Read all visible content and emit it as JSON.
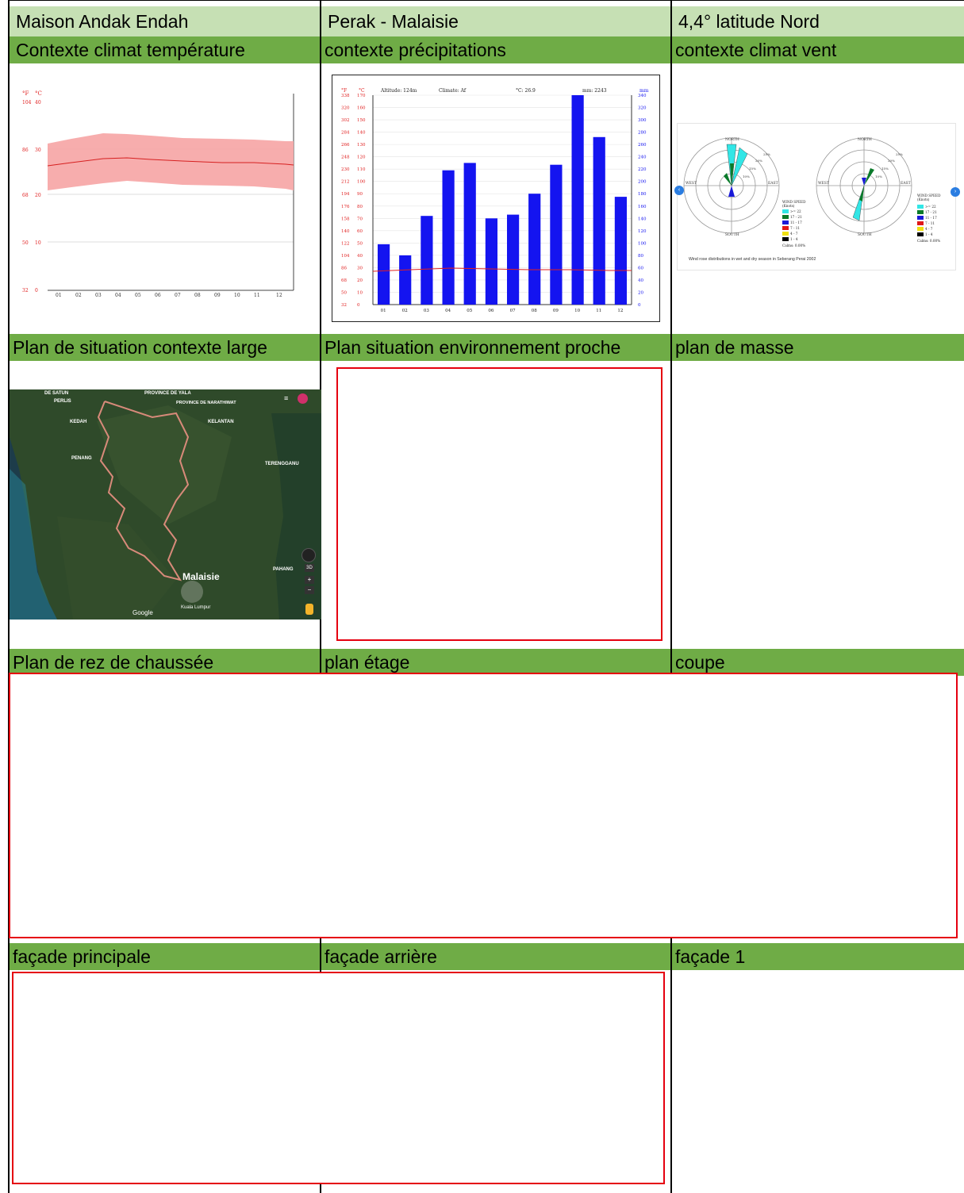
{
  "title_row": [
    "Maison Andak Endah",
    "Perak - Malaisie",
    "4,4° latitude Nord"
  ],
  "row1_headers": [
    "Contexte climat température",
    "contexte précipitations",
    "contexte climat vent"
  ],
  "row2_headers": [
    "Plan de situation contexte large",
    "Plan situation environnement proche",
    "plan  de masse"
  ],
  "row3_headers": [
    "Plan de rez de chaussée",
    "plan étage",
    "coupe"
  ],
  "row4_headers": [
    "façade principale",
    "façade arrière",
    "façade 1"
  ],
  "temp_chart": {
    "f_ticks": [
      "104",
      "86",
      "68",
      "50",
      "32"
    ],
    "c_ticks": [
      "40",
      "30",
      "20",
      "10",
      "0"
    ],
    "f_unit": "°F",
    "c_unit": "°C",
    "months": [
      "01",
      "02",
      "03",
      "04",
      "05",
      "06",
      "07",
      "08",
      "09",
      "10",
      "11",
      "12"
    ],
    "colors": {
      "band": "#f7a9a9",
      "line": "#d62020"
    }
  },
  "precip_chart": {
    "header": {
      "altitude": "Altitude: 124m",
      "climate": "Climate: Af",
      "temp": "°C: 26.9",
      "precip": "mm: 2243"
    },
    "f_unit": "°F",
    "c_unit": "°C",
    "mm_unit": "mm",
    "f_ticks": [
      "338",
      "320",
      "302",
      "284",
      "266",
      "248",
      "230",
      "212",
      "194",
      "176",
      "158",
      "140",
      "122",
      "104",
      "86",
      "68",
      "50",
      "32"
    ],
    "c_ticks": [
      "170",
      "160",
      "150",
      "140",
      "130",
      "120",
      "110",
      "100",
      "90",
      "80",
      "70",
      "60",
      "50",
      "40",
      "30",
      "20",
      "10",
      "0"
    ],
    "mm_ticks": [
      "340",
      "320",
      "300",
      "280",
      "260",
      "240",
      "220",
      "200",
      "180",
      "160",
      "140",
      "120",
      "100",
      "80",
      "60",
      "40",
      "20",
      "0"
    ],
    "colors": {
      "bar": "#1414f0",
      "line": "#e02020",
      "red_text": "#e02020",
      "blue_text": "#1414f0"
    }
  },
  "wind": {
    "labels": {
      "north": "NORTH",
      "south": "SOUTH",
      "west": "WEST",
      "east": "EAST"
    },
    "rings": [
      "25%",
      "20%",
      "15%",
      "10%"
    ],
    "legend_title": "WIND SPEED",
    "legend_unit": "(Knots)",
    "legend_items": [
      {
        "label": ">= 22",
        "color": "#32e6e6"
      },
      {
        "label": "17 - 21",
        "color": "#0a7a2a"
      },
      {
        "label": "11 - 17",
        "color": "#1a1ad8"
      },
      {
        "label": "7 - 11",
        "color": "#e01818"
      },
      {
        "label": "4 - 7",
        "color": "#f0e010"
      },
      {
        "label": "1 - 4",
        "color": "#000000"
      }
    ],
    "calms": "Calms: 0.00%",
    "caption": "Wind rose distributions in wet and dry season in Seberang Perai 2002",
    "colors": {
      "nav": "#2a7de1"
    }
  },
  "map": {
    "labels": {
      "de_satun": "DE SATUN",
      "perlis": "PERLIS",
      "province_yala": "PROVINCE DE YALA",
      "province_narathiwat": "PROVINCE DE NARATHIWAT",
      "kedah": "KEDAH",
      "kelantan": "KELANTAN",
      "penang": "PENANG",
      "terengganu": "TERENGGANU",
      "malaisie": "Malaisie",
      "pahang": "PAHANG",
      "kuala_lumpur": "Kuala Lumpur",
      "google": "Google",
      "btn_3d": "3D"
    },
    "colors": {
      "land": "#2f4a2a",
      "sea": "#1d3c4a",
      "border": "#d88a7a"
    }
  },
  "chart_data": [
    {
      "type": "line",
      "x": [
        "01",
        "02",
        "03",
        "04",
        "05",
        "06",
        "07",
        "08",
        "09",
        "10",
        "11",
        "12"
      ],
      "series": [],
      "ylim": [
        0,
        40
      ]
    },
    {
      "type": "bar",
      "categories": [
        "01",
        "02",
        "03",
        "04",
        "05",
        "06",
        "07",
        "08",
        "09",
        "10",
        "11",
        "12"
      ],
      "values": [
        98,
        80,
        144,
        218,
        230,
        140,
        146,
        180,
        227,
        340,
        272,
        175
      ],
      "ylabel": "mm",
      "ylim": [
        0,
        350
      ]
    }
  ]
}
